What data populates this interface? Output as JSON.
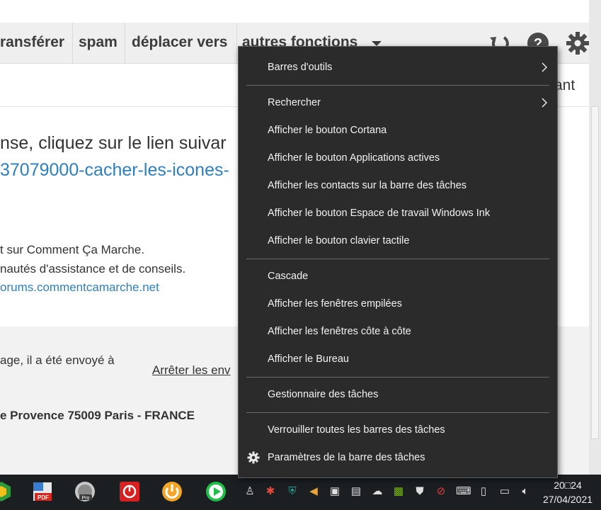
{
  "toolbar": {
    "items": [
      "ransférer",
      "spam",
      "déplacer vers",
      "autres fonctions"
    ]
  },
  "subbar": {
    "text": "ant"
  },
  "content": {
    "line1": "nse, cliquez sur le lien suivar",
    "line2": "37079000-cacher-les-icones-",
    "line3": "t sur Comment Ça Marche.",
    "line4": "nautés d'assistance et de conseils.",
    "line5": "orums.commentcamarche.net",
    "footer1": "age, il a été envoyé à",
    "footer_link": "Arrêter les env",
    "footer2": "e Provence 75009 Paris - FRANCE"
  },
  "menu": {
    "groups": [
      [
        "Barres d'outils"
      ],
      [
        "Rechercher",
        "Afficher le bouton Cortana",
        "Afficher le bouton Applications actives",
        "Afficher les contacts sur la barre des tâches",
        "Afficher le bouton Espace de travail Windows Ink",
        "Afficher le bouton clavier tactile"
      ],
      [
        "Cascade",
        "Afficher les fenêtres empilées",
        "Afficher les fenêtres côte à côte",
        "Afficher le Bureau"
      ],
      [
        "Gestionnaire des tâches"
      ],
      [
        "Verrouiller toutes les barres des tâches",
        "Paramètres de la barre des tâches"
      ]
    ]
  },
  "taskbar": {
    "clock_time": "20□24",
    "clock_date": "27/04/2021"
  },
  "colors": {
    "menu_bg": "#2b2b2b",
    "taskbar_bg": "#1b1f22",
    "link": "#2e7fbd"
  }
}
